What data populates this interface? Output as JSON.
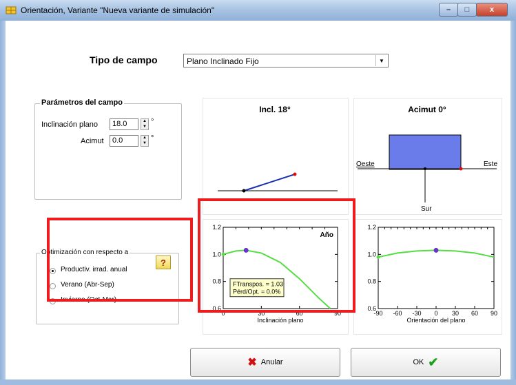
{
  "window": {
    "title": "Orientación, Variante \"Nueva variante de simulación\"",
    "close_glyph": "x",
    "min_glyph": "–",
    "max_glyph": "□"
  },
  "field_type": {
    "label": "Tipo de campo",
    "value": "Plano Inclinado Fijo"
  },
  "params": {
    "title": "Parámetros del campo",
    "tilt_label": "Inclinación plano",
    "tilt_value": "18.0",
    "azimuth_label": "Acimut",
    "azimuth_value": "0.0",
    "unit": "°"
  },
  "tilt_diagram": {
    "title": "Incl. 18°"
  },
  "azimuth_diagram": {
    "title": "Acimut 0°",
    "west": "Oeste",
    "east": "Este",
    "south": "Sur"
  },
  "optimization": {
    "title": "Optimización con respecto a",
    "options": [
      "Productiv. irrad. anual",
      "Verano (Abr-Sep)",
      "Invierno (Oct-Mar)"
    ],
    "selected": 0,
    "help_label": "?"
  },
  "chart_data": [
    {
      "type": "line",
      "title": "Año",
      "xlabel": "Inclinación plano",
      "ylabel": "",
      "xlim": [
        0,
        90
      ],
      "ylim": [
        0.6,
        1.2
      ],
      "xticks": [
        "0",
        "30",
        "60",
        "90"
      ],
      "yticks": [
        "0.6",
        "0.8",
        "1.0",
        "1.2"
      ],
      "x": [
        0,
        10,
        18,
        30,
        45,
        60,
        75,
        90
      ],
      "series": [
        {
          "values": [
            1.0,
            1.025,
            1.03,
            1.01,
            0.94,
            0.82,
            0.68,
            0.55
          ]
        }
      ],
      "marker": {
        "x": 18,
        "y": 1.03
      },
      "annotation": [
        "FTranspos. = 1.03",
        "Pérd/Opt. = 0.0%"
      ],
      "colors": {
        "line": "#55dd44",
        "marker": "#6633cc",
        "box": "#ffffcc"
      }
    },
    {
      "type": "line",
      "title": "",
      "xlabel": "Orientación del plano",
      "ylabel": "",
      "xlim": [
        -90,
        90
      ],
      "ylim": [
        0.6,
        1.2
      ],
      "xticks": [
        "-90",
        "-60",
        "-30",
        "0",
        "30",
        "60",
        "90"
      ],
      "yticks": [
        "0.6",
        "0.8",
        "1.0",
        "1.2"
      ],
      "x": [
        -90,
        -60,
        -30,
        0,
        30,
        60,
        90
      ],
      "series": [
        {
          "values": [
            0.98,
            1.01,
            1.025,
            1.03,
            1.025,
            1.01,
            0.98
          ]
        }
      ],
      "marker": {
        "x": 0,
        "y": 1.03
      },
      "colors": {
        "line": "#55dd44",
        "marker": "#6633cc"
      }
    }
  ],
  "buttons": {
    "cancel": "Anular",
    "ok": "OK"
  },
  "colors": {
    "highlight": "#ee1c1c",
    "azimuth_rect": "#6a7bea",
    "tilt_line": "#1a2fb0"
  }
}
